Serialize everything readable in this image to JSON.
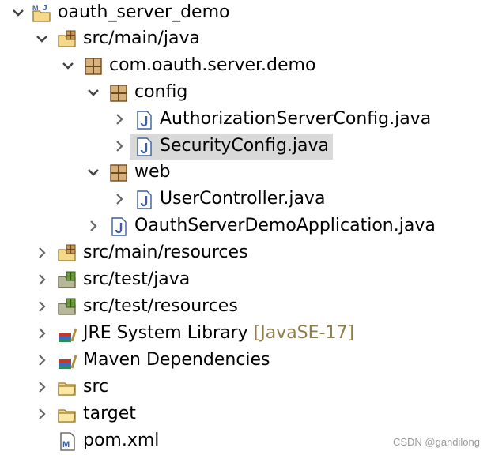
{
  "tree": {
    "items": [
      {
        "label": "oauth_server_demo"
      },
      {
        "label": "src/main/java"
      },
      {
        "label": "com.oauth.server.demo"
      },
      {
        "label": "config"
      },
      {
        "label": "AuthorizationServerConfig.java"
      },
      {
        "label": "SecurityConfig.java"
      },
      {
        "label": "web"
      },
      {
        "label": "UserController.java"
      },
      {
        "label": "OauthServerDemoApplication.java"
      },
      {
        "label": "src/main/resources"
      },
      {
        "label": "src/test/java"
      },
      {
        "label": "src/test/resources"
      },
      {
        "label": "JRE System Library",
        "decoration": "[JavaSE-17]"
      },
      {
        "label": "Maven Dependencies"
      },
      {
        "label": "src"
      },
      {
        "label": "target"
      },
      {
        "label": "pom.xml"
      }
    ]
  },
  "watermark": "CSDN @gandilong",
  "colors": {
    "selection": "#d9d9d9",
    "decoration": "#8e7d47",
    "package": "#8b5a2b",
    "folder": "#f5d98a",
    "java_file": "#3a5ea0"
  },
  "icons": {
    "project": "maven-project-icon",
    "source_folder": "source-folder-icon",
    "package": "package-icon",
    "java_file": "java-file-icon",
    "library": "library-icon",
    "folder": "folder-icon",
    "xml_file": "maven-xml-file-icon"
  }
}
